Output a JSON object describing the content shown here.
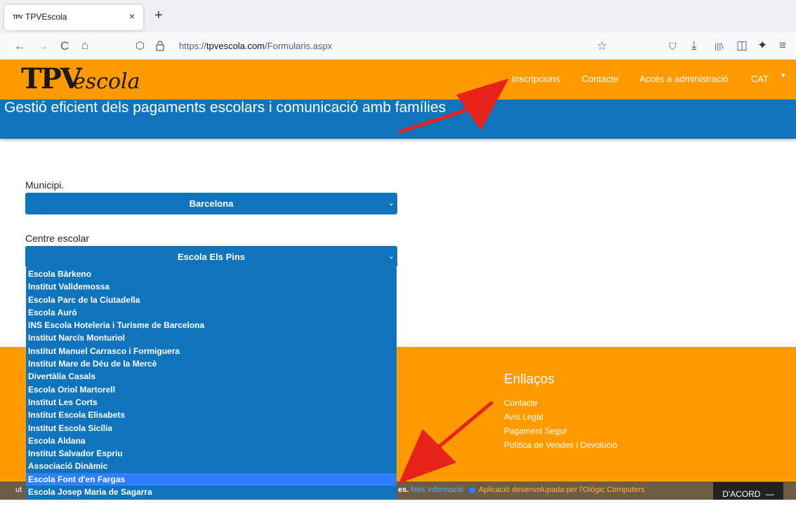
{
  "browser": {
    "tab_title": "TPVEscola",
    "tab_favicon": "TPV",
    "tab_close": "×",
    "new_tab": "+",
    "url_prefix": "https://",
    "url_host": "tpvescola.com",
    "url_path": "/Formularis.aspx",
    "icons": {
      "back": "←",
      "forward": "→",
      "reload": "C",
      "home": "⌂",
      "shield": "⬡",
      "lock": "🔒",
      "bookmark": "☆",
      "pocket": "⛉",
      "download": "⤓",
      "library": "|||\\",
      "sidebar": "◫",
      "extension": "✦",
      "menu": "≡"
    }
  },
  "site": {
    "logo_bold": "TPV",
    "logo_script": "escola",
    "nav": [
      "Inscripcions",
      "Contacte",
      "Accés a administració",
      "CAT"
    ],
    "nav_caret": "▾",
    "banner": "Gestió eficient dels pagaments escolars i comunicació amb famílies"
  },
  "form": {
    "municipi_label": "Municipi.",
    "municipi_value": "Barcelona",
    "centre_label": "Centre escolar",
    "centre_value": "Escola Els Pins",
    "chevron": "⌄",
    "options": [
      "Escola Bàrkeno",
      "Institut Valldemossa",
      "Escola Parc de la Ciutadella",
      "Escola Auró",
      "INS Escola Hoteleria i Turisme de Barcelona",
      "Institut Narcís Monturiol",
      "Institut Manuel Carrasco i Formiguera",
      "Institut Mare de Déu de la Mercè",
      "Divertàlia Casals",
      "Escola Oriol Martorell",
      "Institut Les Corts",
      "Institut Escola Elisabets",
      "Institut Escola Sicília",
      "Escola Aldana",
      "Institut Salvador Espriu",
      "Associació Dinàmic",
      "Escola Font d'en Fargas",
      "Escola Josep Maria de Sagarra"
    ],
    "selected_option": "Escola Font d'en Fargas"
  },
  "footer": {
    "links_title": "Enllaços",
    "links": [
      "Contacte",
      "Avís Legal",
      "Pagament Segur",
      "Política de Vendes i Devolució"
    ],
    "cookie_left": "ut",
    "cookie_mid": "es.",
    "cookie_more": "Més Informació",
    "cookie_credit": "Aplicació desenvolupada per l'Ològic Computers",
    "accept_label": "D'ACORD",
    "accept_icon": "—"
  },
  "colors": {
    "orange": "#ff9a00",
    "blue": "#0f74bb",
    "highlight": "#2d7fff",
    "arrow": "#e8231a"
  }
}
